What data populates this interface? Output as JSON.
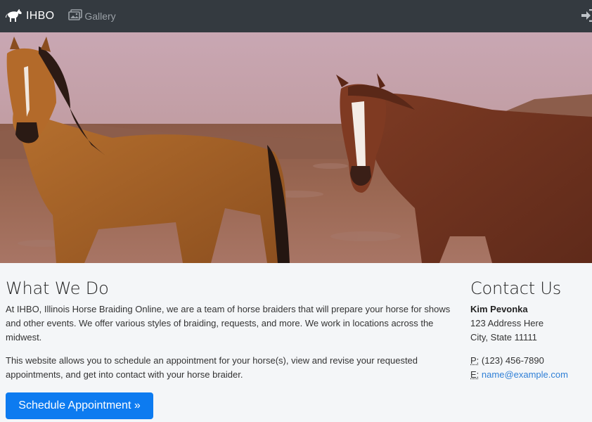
{
  "nav": {
    "brand_icon": "horse-icon",
    "brand": "IHBO",
    "gallery_icon": "images-icon",
    "gallery": "Gallery",
    "login_icon": "sign-in-icon"
  },
  "hero": {
    "image": "two-horses-photo",
    "subject": "horses"
  },
  "what_we_do": {
    "heading": "What We Do",
    "paragraph1": "At IHBO, Illinois Horse Braiding Online, we are a team of horse braiders that will prepare your horse for shows and other events. We offer various styles of braiding, requests, and more. We work in locations across the midwest.",
    "paragraph2": "This website allows you to schedule an appointment for your horse(s), view and revise your requested appointments, and get into contact with your horse braider.",
    "button": "Schedule Appointment »"
  },
  "contact": {
    "heading": "Contact Us",
    "name": "Kim Pevonka",
    "address1": "123 Address Here",
    "address2": "City, State 11111",
    "phone_label": "P:",
    "phone": "(123) 456-7890",
    "email_label": "E:",
    "email": "name@example.com"
  },
  "colors": {
    "navbar": "#343a40",
    "page_bg": "#f4f6f8",
    "button": "#0d7bf0",
    "link": "#2f7fd6"
  }
}
